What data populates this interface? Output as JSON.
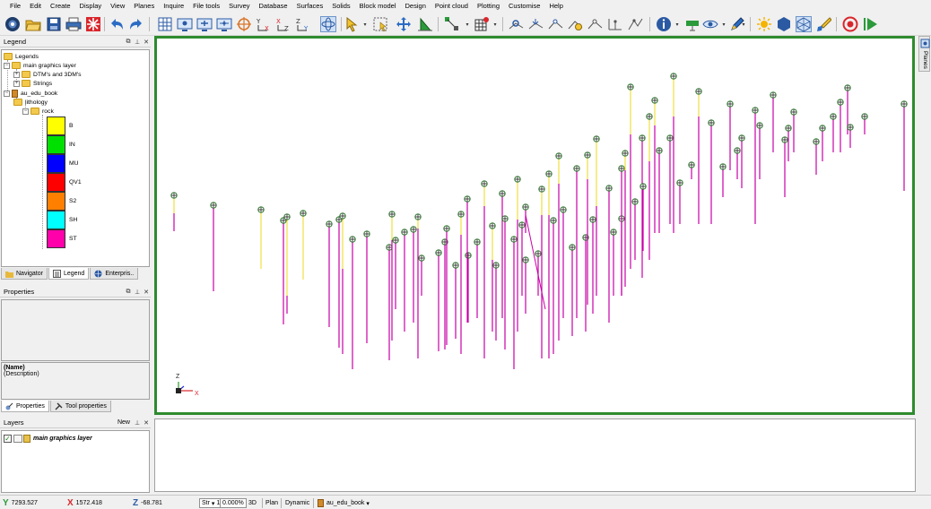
{
  "menu": [
    "File",
    "Edit",
    "Create",
    "Display",
    "View",
    "Planes",
    "Inquire",
    "File tools",
    "Survey",
    "Database",
    "Surfaces",
    "Solids",
    "Block model",
    "Design",
    "Point cloud",
    "Plotting",
    "Customise",
    "Help"
  ],
  "legend": {
    "title": "Legend",
    "tree": {
      "root": "Legends",
      "layer": "main graphics layer",
      "dtm": "DTM's and 3DM's",
      "strings": "Strings",
      "book": "au_edu_book",
      "lithology": "lithology",
      "rock": "rock"
    },
    "swatches": [
      {
        "label": "B",
        "color": "#ffff00"
      },
      {
        "label": "IN",
        "color": "#00e000"
      },
      {
        "label": "MU",
        "color": "#0000ff"
      },
      {
        "label": "QV1",
        "color": "#ff0000"
      },
      {
        "label": "S2",
        "color": "#ff7f00"
      },
      {
        "label": "SH",
        "color": "#00ffff"
      },
      {
        "label": "ST",
        "color": "#ff00aa"
      }
    ],
    "tabs": [
      "Navigator",
      "Legend",
      "Enterpris.."
    ]
  },
  "properties": {
    "title": "Properties",
    "name_label": "(Name)",
    "desc_label": "(Description)",
    "tabs": [
      "Properties",
      "Tool properties"
    ]
  },
  "layers": {
    "title": "Layers",
    "new_label": "New",
    "items": [
      {
        "name": "main graphics layer",
        "checked": true
      }
    ]
  },
  "viewport": {
    "axis_z": "Z",
    "axis_x": "X",
    "border_color": "#2e8b2e"
  },
  "right_tab": "Planes",
  "status": {
    "y": "7293.527",
    "x": "1572.418",
    "z": "-68.781",
    "str": "Str",
    "str_num": "1",
    "zoom": "0.000%",
    "mode_3d": "3D",
    "plan": "Plan",
    "dynamic": "Dynamic",
    "book": "au_edu_book"
  },
  "drillholes": [
    {
      "c": [
        194,
        218
      ],
      "s": [
        [
          "y",
          218,
          238
        ],
        [
          "m",
          238,
          258
        ]
      ]
    },
    {
      "c": [
        238,
        229
      ],
      "s": [
        [
          "m",
          229,
          325
        ]
      ]
    },
    {
      "c": [
        291,
        234
      ],
      "s": [
        [
          "y",
          234,
          300
        ]
      ]
    },
    {
      "c": [
        316,
        246
      ],
      "s": [
        [
          "m",
          246,
          362
        ]
      ]
    },
    {
      "c": [
        320,
        242
      ],
      "s": [
        [
          "y",
          242,
          330
        ],
        [
          "m",
          330,
          350
        ]
      ]
    },
    {
      "c": [
        338,
        238
      ],
      "s": [
        [
          "y",
          238,
          312
        ]
      ]
    },
    {
      "c": [
        367,
        250
      ],
      "s": [
        [
          "m",
          250,
          365
        ]
      ]
    },
    {
      "c": [
        378,
        245
      ],
      "s": [
        [
          "m",
          245,
          388
        ]
      ]
    },
    {
      "c": [
        382,
        241
      ],
      "s": [
        [
          "y",
          241,
          300
        ],
        [
          "m",
          300,
          395
        ]
      ]
    },
    {
      "c": [
        393,
        267
      ],
      "s": [
        [
          "m",
          267,
          412
        ]
      ]
    },
    {
      "c": [
        409,
        261
      ],
      "s": [
        [
          "m",
          261,
          383
        ]
      ]
    },
    {
      "c": [
        434,
        276
      ],
      "s": [
        [
          "m",
          276,
          402
        ]
      ]
    },
    {
      "c": [
        437,
        239
      ],
      "s": [
        [
          "y",
          239,
          268
        ],
        [
          "m",
          268,
          380
        ]
      ]
    },
    {
      "c": [
        441,
        268
      ],
      "s": [
        [
          "m",
          268,
          345
        ]
      ]
    },
    {
      "c": [
        451,
        259
      ],
      "s": [
        [
          "m",
          259,
          370
        ]
      ]
    },
    {
      "c": [
        461,
        256
      ],
      "s": [
        [
          "m",
          256,
          360
        ]
      ]
    },
    {
      "c": [
        466,
        242
      ],
      "s": [
        [
          "y",
          242,
          255
        ],
        [
          "m",
          255,
          400
        ]
      ]
    },
    {
      "c": [
        470,
        288
      ],
      "s": [
        [
          "m",
          288,
          330
        ]
      ]
    },
    {
      "c": [
        489,
        282
      ],
      "s": [
        [
          "m",
          282,
          392
        ]
      ]
    },
    {
      "c": [
        496,
        270
      ],
      "s": [
        [
          "m",
          270,
          390
        ]
      ]
    },
    {
      "c": [
        498,
        255
      ],
      "s": [
        [
          "m",
          255,
          385
        ]
      ]
    },
    {
      "c": [
        508,
        296
      ],
      "s": [
        [
          "m",
          296,
          378
        ]
      ]
    },
    {
      "c": [
        514,
        239
      ],
      "s": [
        [
          "y",
          239,
          262
        ],
        [
          "m",
          262,
          395
        ]
      ]
    },
    {
      "c": [
        522,
        285
      ],
      "s": [
        [
          "m",
          285,
          360
        ]
      ]
    },
    {
      "c": [
        521,
        222
      ],
      "s": [
        [
          "m",
          222,
          360
        ]
      ]
    },
    {
      "c": [
        532,
        270
      ],
      "s": [
        [
          "m",
          270,
          355
        ]
      ]
    },
    {
      "c": [
        540,
        205
      ],
      "s": [
        [
          "y",
          205,
          230
        ],
        [
          "m",
          230,
          400
        ]
      ]
    },
    {
      "c": [
        549,
        252
      ],
      "s": [
        [
          "y",
          252,
          290
        ],
        [
          "m",
          290,
          370
        ]
      ]
    },
    {
      "c": [
        553,
        296
      ],
      "s": [
        [
          "m",
          296,
          380
        ]
      ]
    },
    {
      "c": [
        560,
        216
      ],
      "s": [
        [
          "m",
          216,
          355
        ]
      ]
    },
    {
      "c": [
        563,
        244
      ],
      "s": [
        [
          "m",
          244,
          390
        ]
      ]
    },
    {
      "c": [
        573,
        267
      ],
      "s": [
        [
          "m",
          267,
          412
        ]
      ]
    },
    {
      "c": [
        577,
        200
      ],
      "s": [
        [
          "y",
          200,
          245
        ],
        [
          "m",
          245,
          370
        ]
      ]
    },
    {
      "c": [
        582,
        251
      ],
      "s": [
        [
          "m",
          251,
          330
        ]
      ]
    },
    {
      "c": [
        586,
        290
      ],
      "s": [
        [
          "m",
          290,
          350
        ]
      ]
    },
    {
      "c": [
        586,
        231
      ],
      "s": [
        [
          "m",
          231,
          260
        ]
      ]
    },
    {
      "c": [
        600,
        283
      ],
      "s": [
        [
          "m",
          283,
          330
        ]
      ]
    },
    {
      "c": [
        604,
        211
      ],
      "s": [
        [
          "y",
          211,
          240
        ],
        [
          "m",
          240,
          400
        ]
      ]
    },
    {
      "c": [
        612,
        194
      ],
      "s": [
        [
          "y",
          194,
          240
        ],
        [
          "m",
          240,
          400
        ]
      ]
    },
    {
      "c": [
        617,
        246
      ],
      "s": [
        [
          "m",
          246,
          395
        ]
      ]
    },
    {
      "c": [
        623,
        174
      ],
      "s": [
        [
          "y",
          174,
          205
        ],
        [
          "m",
          205,
          380
        ]
      ]
    },
    {
      "c": [
        628,
        234
      ],
      "s": [
        [
          "m",
          234,
          355
        ]
      ]
    },
    {
      "c": [
        638,
        276
      ],
      "s": [
        [
          "m",
          276,
          375
        ]
      ]
    },
    {
      "c": [
        643,
        188
      ],
      "s": [
        [
          "m",
          188,
          355
        ]
      ]
    },
    {
      "c": [
        653,
        265
      ],
      "s": [
        [
          "m",
          265,
          370
        ]
      ]
    },
    {
      "c": [
        655,
        173
      ],
      "s": [
        [
          "y",
          173,
          200
        ],
        [
          "m",
          200,
          340
        ]
      ]
    },
    {
      "c": [
        661,
        245
      ],
      "s": [
        [
          "m",
          245,
          350
        ]
      ]
    },
    {
      "c": [
        665,
        155
      ],
      "s": [
        [
          "y",
          155,
          230
        ],
        [
          "m",
          230,
          330
        ]
      ]
    },
    {
      "c": [
        679,
        210
      ],
      "s": [
        [
          "m",
          210,
          360
        ]
      ]
    },
    {
      "c": [
        684,
        259
      ],
      "s": [
        [
          "m",
          259,
          330
        ]
      ]
    },
    {
      "c": [
        693,
        244
      ],
      "s": [
        [
          "m",
          244,
          330
        ]
      ]
    },
    {
      "c": [
        693,
        188
      ],
      "s": [
        [
          "m",
          188,
          330
        ]
      ]
    },
    {
      "c": [
        697,
        171
      ],
      "s": [
        [
          "y",
          171,
          190
        ],
        [
          "m",
          190,
          320
        ]
      ]
    },
    {
      "c": [
        703,
        97
      ],
      "s": [
        [
          "y",
          97,
          150
        ],
        [
          "m",
          150,
          300
        ]
      ]
    },
    {
      "c": [
        708,
        225
      ],
      "s": [
        [
          "m",
          225,
          290
        ]
      ]
    },
    {
      "c": [
        716,
        154
      ],
      "s": [
        [
          "m",
          154,
          310
        ]
      ]
    },
    {
      "c": [
        717,
        208
      ],
      "s": [
        [
          "m",
          208,
          280
        ]
      ]
    },
    {
      "c": [
        724,
        130
      ],
      "s": [
        [
          "y",
          130,
          180
        ],
        [
          "m",
          180,
          290
        ]
      ]
    },
    {
      "c": [
        730,
        112
      ],
      "s": [
        [
          "y",
          112,
          140
        ],
        [
          "m",
          140,
          260
        ]
      ]
    },
    {
      "c": [
        735,
        168
      ],
      "s": [
        [
          "m",
          168,
          260
        ]
      ]
    },
    {
      "c": [
        747,
        154
      ],
      "s": [
        [
          "m",
          154,
          250
        ]
      ]
    },
    {
      "c": [
        751,
        85
      ],
      "s": [
        [
          "y",
          85,
          130
        ],
        [
          "m",
          130,
          260
        ]
      ]
    },
    {
      "c": [
        758,
        204
      ],
      "s": [
        [
          "m",
          204,
          250
        ]
      ]
    },
    {
      "c": [
        779,
        102
      ],
      "s": [
        [
          "y",
          102,
          130
        ],
        [
          "m",
          130,
          250
        ]
      ]
    },
    {
      "c": [
        771,
        184
      ],
      "s": [
        [
          "m",
          184,
          200
        ]
      ]
    },
    {
      "c": [
        793,
        137
      ],
      "s": [
        [
          "m",
          137,
          250
        ]
      ]
    },
    {
      "c": [
        806,
        186
      ],
      "s": [
        [
          "m",
          186,
          220
        ]
      ]
    },
    {
      "c": [
        814,
        116
      ],
      "s": [
        [
          "m",
          116,
          190
        ]
      ]
    },
    {
      "c": [
        822,
        168
      ],
      "s": [
        [
          "m",
          168,
          200
        ]
      ]
    },
    {
      "c": [
        827,
        154
      ],
      "s": [
        [
          "m",
          154,
          210
        ]
      ]
    },
    {
      "c": [
        842,
        123
      ],
      "s": [
        [
          "m",
          123,
          250
        ]
      ]
    },
    {
      "c": [
        847,
        140
      ],
      "s": [
        [
          "m",
          140,
          200
        ]
      ]
    },
    {
      "c": [
        862,
        106
      ],
      "s": [
        [
          "m",
          106,
          170
        ]
      ]
    },
    {
      "c": [
        875,
        156
      ],
      "s": [
        [
          "m",
          156,
          220
        ]
      ]
    },
    {
      "c": [
        879,
        143
      ],
      "s": [
        [
          "m",
          143,
          180
        ]
      ]
    },
    {
      "c": [
        885,
        125
      ],
      "s": [
        [
          "m",
          125,
          170
        ]
      ]
    },
    {
      "c": [
        910,
        158
      ],
      "s": [
        [
          "m",
          158,
          195
        ]
      ]
    },
    {
      "c": [
        917,
        143
      ],
      "s": [
        [
          "m",
          143,
          180
        ]
      ]
    },
    {
      "c": [
        929,
        130
      ],
      "s": [
        [
          "m",
          130,
          170
        ]
      ]
    },
    {
      "c": [
        937,
        114
      ],
      "s": [
        [
          "m",
          114,
          170
        ]
      ]
    },
    {
      "c": [
        945,
        98
      ],
      "s": [
        [
          "m",
          98,
          150
        ]
      ]
    },
    {
      "c": [
        948,
        142
      ],
      "s": [
        [
          "m",
          142,
          165
        ]
      ]
    },
    {
      "c": [
        964,
        130
      ],
      "s": [
        [
          "m",
          130,
          150
        ]
      ]
    },
    {
      "c": [
        1008,
        116
      ],
      "s": [
        [
          "m",
          116,
          213
        ]
      ]
    }
  ]
}
